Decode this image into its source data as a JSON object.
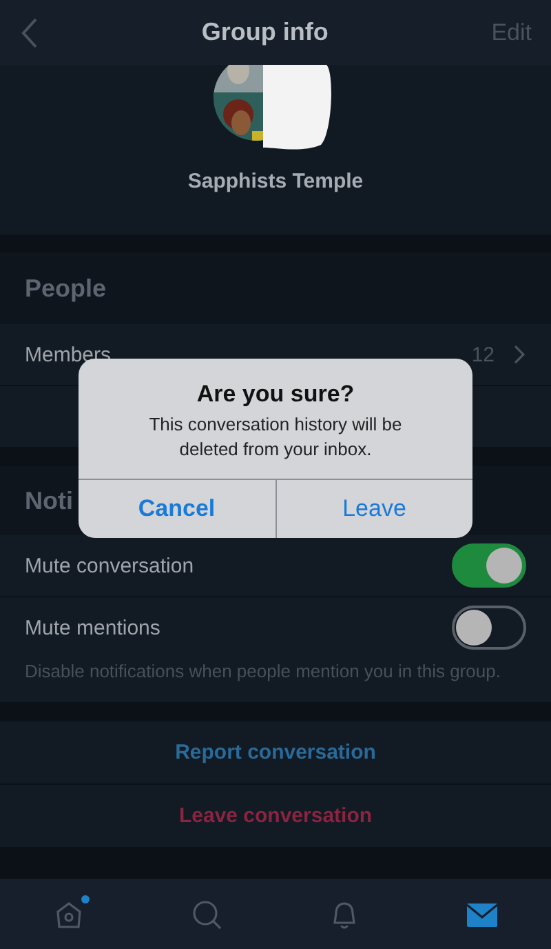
{
  "nav": {
    "title": "Group info",
    "edit": "Edit"
  },
  "group": {
    "name": "Sapphists Temple"
  },
  "people": {
    "header": "People",
    "members": {
      "label": "Members",
      "count": "12"
    }
  },
  "notifications": {
    "header": "Noti",
    "toggles": [
      {
        "label": "Mute conversation",
        "on": true
      },
      {
        "label": "Mute mentions",
        "on": false,
        "hint": "Disable notifications when people mention you in this group."
      }
    ]
  },
  "actions": [
    {
      "label": "Report conversation",
      "kind": "normal"
    },
    {
      "label": "Leave conversation",
      "kind": "destructive"
    }
  ],
  "tabs": [
    {
      "kind": "home",
      "selected": false,
      "badge": true
    },
    {
      "kind": "search",
      "selected": false,
      "badge": false
    },
    {
      "kind": "bell",
      "selected": false,
      "badge": false
    },
    {
      "kind": "mail",
      "selected": true,
      "badge": false
    }
  ],
  "dialog": {
    "title": "Are you sure?",
    "message": "This conversation history will be deleted from your inbox.",
    "buttons": [
      "Cancel",
      "Leave"
    ]
  }
}
